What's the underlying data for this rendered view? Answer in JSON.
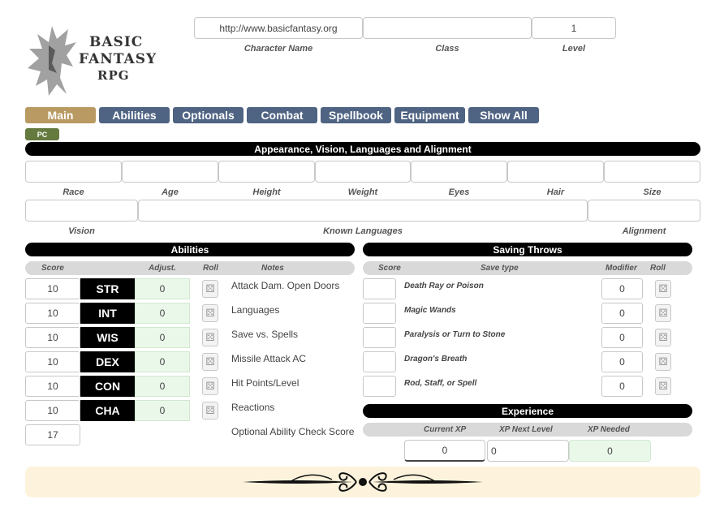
{
  "logo": {
    "line1": "BASIC",
    "line2": "FANTASY",
    "line3": "RPG"
  },
  "header": {
    "character_name": {
      "value": "http://www.basicfantasy.org",
      "label": "Character Name"
    },
    "class": {
      "value": "",
      "label": "Class"
    },
    "level": {
      "value": "1",
      "label": "Level"
    }
  },
  "tabs": [
    "Main",
    "Abilities",
    "Optionals",
    "Combat",
    "Spellbook",
    "Equipment",
    "Show All"
  ],
  "pc_badge": "PC",
  "appearance": {
    "title": "Appearance, Vision, Languages and Alignment",
    "row1_labels": [
      "Race",
      "Age",
      "Height",
      "Weight",
      "Eyes",
      "Hair",
      "Size"
    ],
    "row2_labels": {
      "vision": "Vision",
      "languages": "Known Languages",
      "alignment": "Alignment"
    }
  },
  "abilities": {
    "title": "Abilities",
    "headers": {
      "score": "Score",
      "adjust": "Adjust.",
      "roll": "Roll",
      "notes": "Notes"
    },
    "rows": [
      {
        "score": "10",
        "name": "STR",
        "adjust": "0",
        "note": "Attack Dam. Open Doors"
      },
      {
        "score": "10",
        "name": "INT",
        "adjust": "0",
        "note": "Languages"
      },
      {
        "score": "10",
        "name": "WIS",
        "adjust": "0",
        "note": "Save vs. Spells"
      },
      {
        "score": "10",
        "name": "DEX",
        "adjust": "0",
        "note": "Missile Attack AC"
      },
      {
        "score": "10",
        "name": "CON",
        "adjust": "0",
        "note": "Hit Points/Level"
      },
      {
        "score": "10",
        "name": "CHA",
        "adjust": "0",
        "note": "Reactions"
      }
    ],
    "optional_check": {
      "score": "17",
      "label": "Optional Ability Check Score"
    }
  },
  "saving_throws": {
    "title": "Saving Throws",
    "headers": {
      "score": "Score",
      "type": "Save type",
      "modifier": "Modifier",
      "roll": "Roll"
    },
    "rows": [
      {
        "type": "Death Ray or Poison",
        "modifier": "0"
      },
      {
        "type": "Magic Wands",
        "modifier": "0"
      },
      {
        "type": "Paralysis or Turn to Stone",
        "modifier": "0"
      },
      {
        "type": "Dragon's Breath",
        "modifier": "0"
      },
      {
        "type": "Rod, Staff, or Spell",
        "modifier": "0"
      }
    ]
  },
  "experience": {
    "title": "Experience",
    "headers": {
      "current": "Current XP",
      "next": "XP Next Level",
      "needed": "XP Needed"
    },
    "current": "0",
    "next": "0",
    "needed": "0"
  },
  "colors": {
    "tab": "#4f6382",
    "tab_active": "#b89a62",
    "pc_badge": "#657a3f",
    "footer": "#fdf3dc",
    "adjust_bg": "#eaf8ea"
  },
  "icons": {
    "roll": "dice-icon",
    "logo": "dragon-icon",
    "footer": "flourish-ornament"
  }
}
